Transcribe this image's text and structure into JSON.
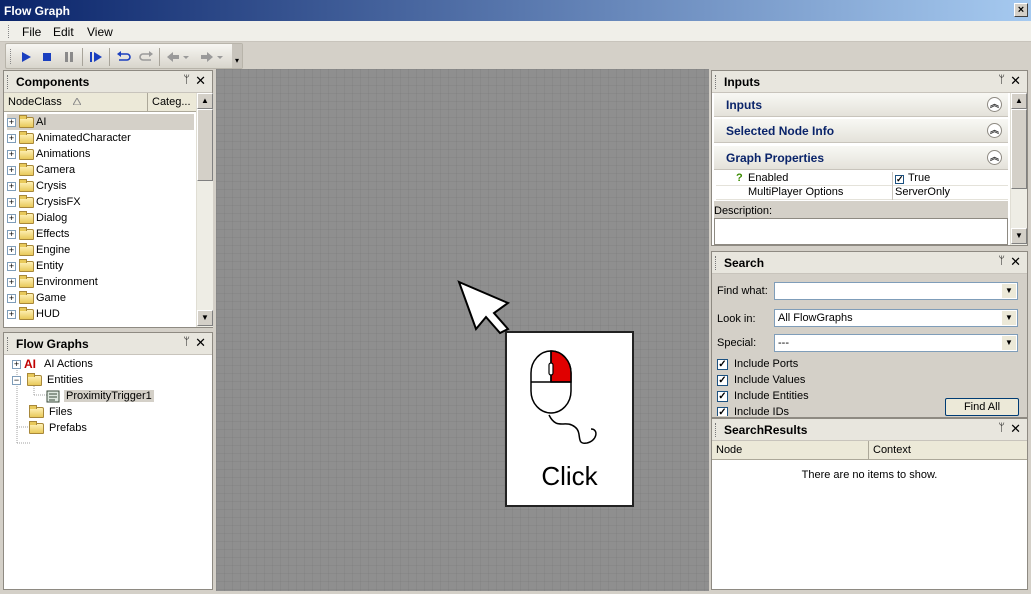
{
  "window": {
    "title": "Flow Graph",
    "close_glyph": "×"
  },
  "menu": {
    "file": "File",
    "edit": "Edit",
    "view": "View"
  },
  "toolbar": {
    "overflow_glyph": "▾"
  },
  "components": {
    "title": "Components",
    "col_nodeclass": "NodeClass",
    "col_category": "Categ...",
    "items": [
      "AI",
      "AnimatedCharacter",
      "Animations",
      "Camera",
      "Crysis",
      "CrysisFX",
      "Dialog",
      "Effects",
      "Engine",
      "Entity",
      "Environment",
      "Game",
      "HUD"
    ]
  },
  "flowgraphs": {
    "title": "Flow Graphs",
    "ai_actions": "AI Actions",
    "ai_badge": "AI",
    "entities": "Entities",
    "trigger": "ProximityTrigger1",
    "files": "Files",
    "prefabs": "Prefabs"
  },
  "overlay": {
    "click_label": "Click",
    "accent": "#e00000"
  },
  "inputs": {
    "title": "Inputs",
    "sec_inputs": "Inputs",
    "sec_selected": "Selected Node Info",
    "sec_graph": "Graph Properties",
    "prop_enabled": "Enabled",
    "prop_enabled_value": "True",
    "prop_mp": "MultiPlayer Options",
    "prop_mp_value": "ServerOnly",
    "help_glyph": "?",
    "description_label": "Description:"
  },
  "search": {
    "title": "Search",
    "find_label": "Find what:",
    "find_value": "",
    "lookin_label": "Look in:",
    "lookin_value": "All FlowGraphs",
    "special_label": "Special:",
    "special_value": "---",
    "include_ports": "Include Ports",
    "include_values": "Include Values",
    "include_entities": "Include Entities",
    "include_ids": "Include IDs",
    "find_all": "Find All"
  },
  "results": {
    "title": "SearchResults",
    "col_node": "Node",
    "col_context": "Context",
    "empty": "There are no items to show."
  },
  "glyphs": {
    "pin": "ᛘ",
    "close": "✕",
    "plus": "+",
    "minus": "−",
    "check": "✓",
    "up": "▲",
    "down": "▼",
    "collapse": "︽"
  }
}
